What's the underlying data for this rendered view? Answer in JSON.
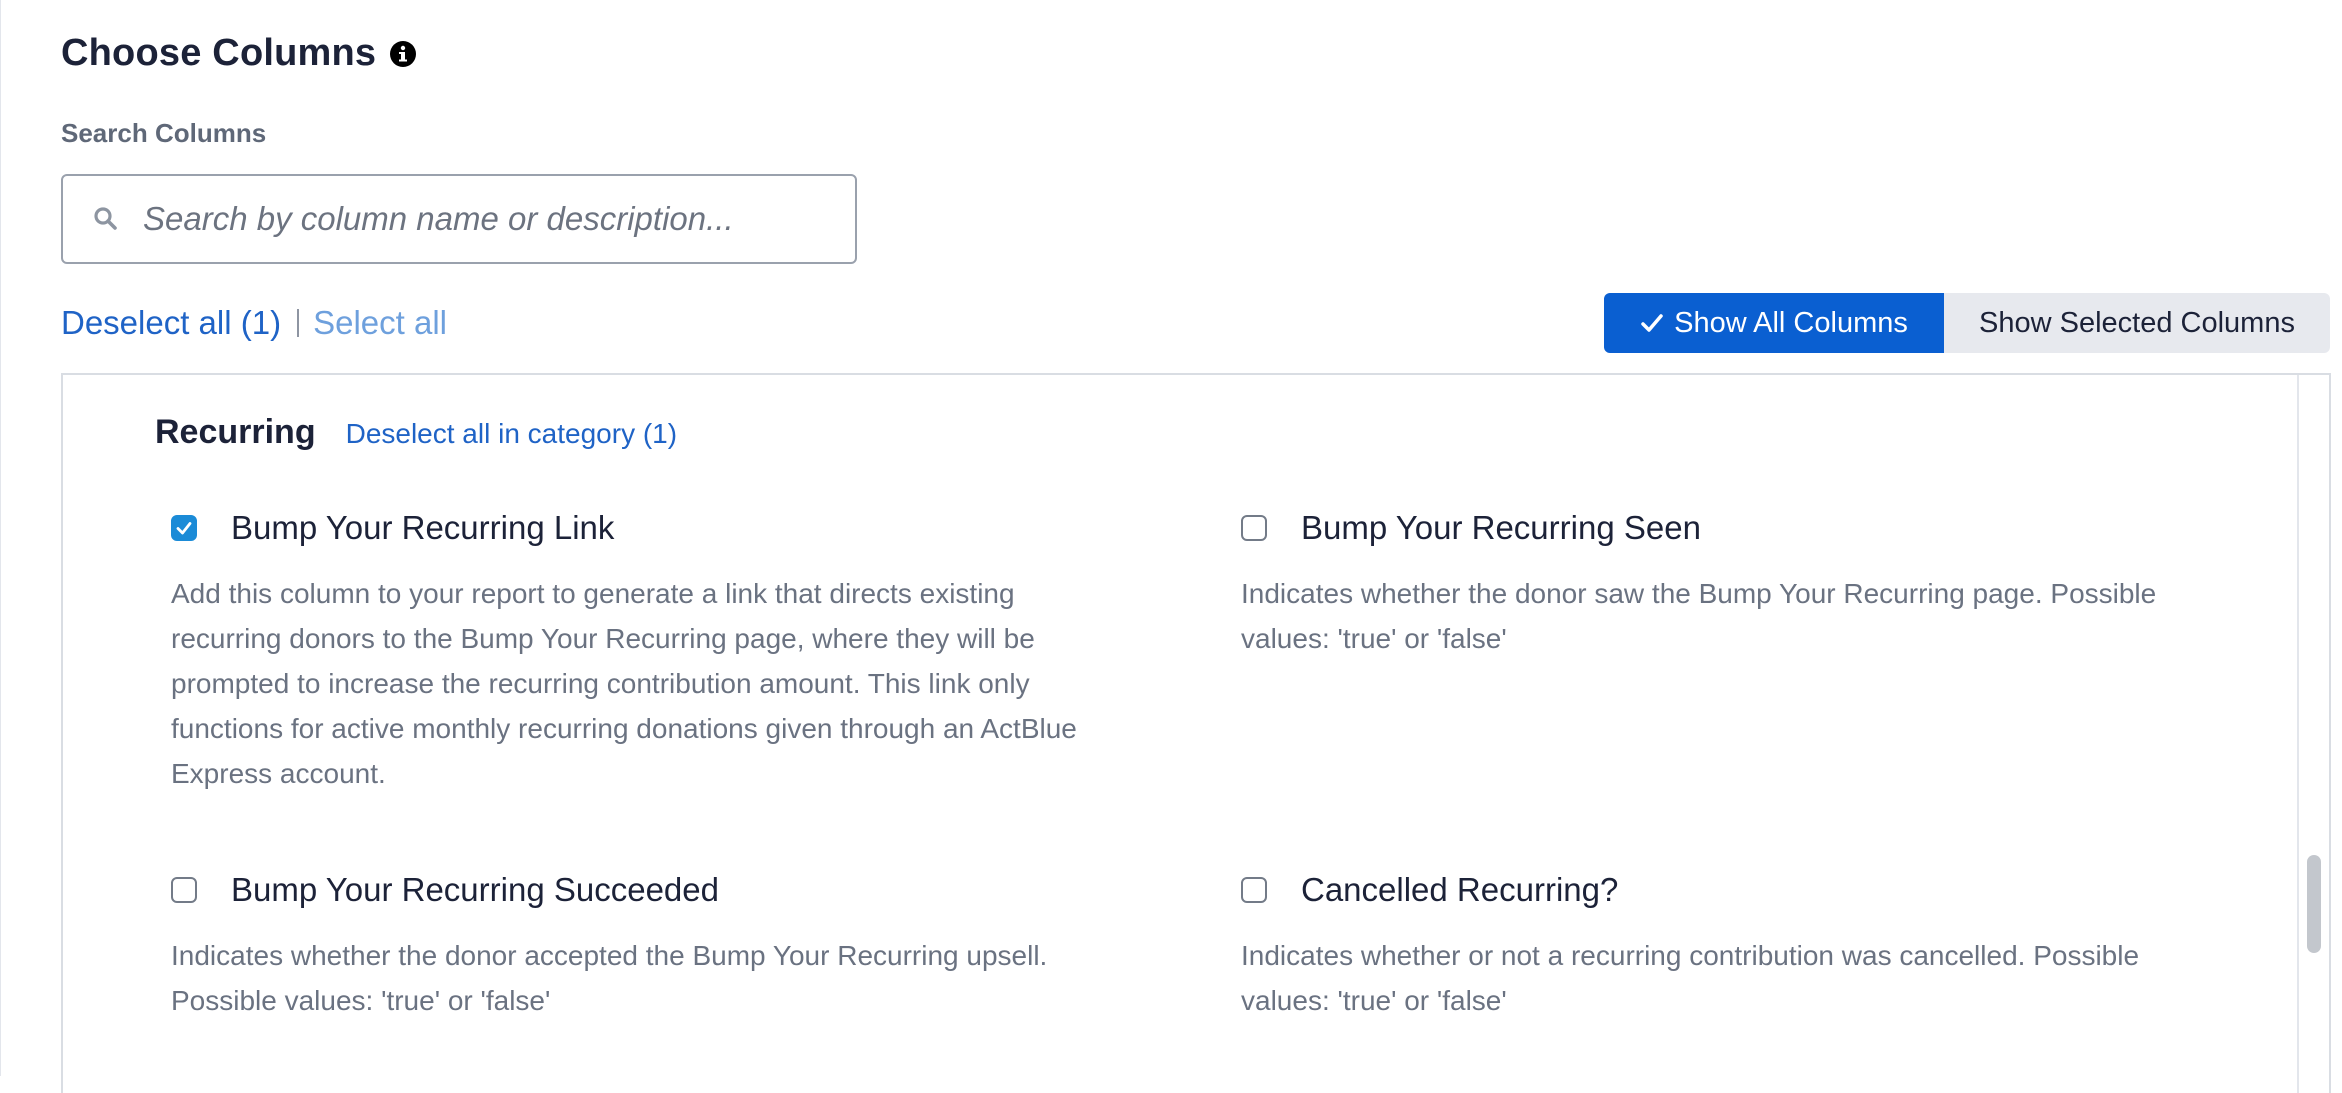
{
  "header": {
    "title": "Choose Columns",
    "info_icon": "info-circle-icon"
  },
  "search": {
    "label": "Search Columns",
    "placeholder": "Search by column name or description...",
    "value": "",
    "icon": "search-icon"
  },
  "selection": {
    "deselect_all": "Deselect all (1)",
    "select_all": "Select all"
  },
  "view_toggle": {
    "show_all": "Show All Columns",
    "show_selected": "Show Selected Columns",
    "active": "show_all"
  },
  "category": {
    "title": "Recurring",
    "deselect_label": "Deselect all in category (1)",
    "columns": [
      {
        "name": "Bump Your Recurring Link",
        "checked": true,
        "description": "Add this column to your report to generate a link that directs existing recurring donors to the Bump Your Recurring page, where they will be prompted to increase the recurring contribution amount. This link only functions for active monthly recurring donations given through an ActBlue Express account."
      },
      {
        "name": "Bump Your Recurring Seen",
        "checked": false,
        "description": "Indicates whether the donor saw the Bump Your Recurring page. Possible values: 'true' or 'false'"
      },
      {
        "name": "Bump Your Recurring Succeeded",
        "checked": false,
        "description": "Indicates whether the donor accepted the Bump Your Recurring upsell. Possible values: 'true' or 'false'"
      },
      {
        "name": "Cancelled Recurring?",
        "checked": false,
        "description": "Indicates whether or not a recurring contribution was cancelled. Possible values: 'true' or 'false'"
      }
    ]
  },
  "colors": {
    "primary": "#0a5fd1",
    "link": "#1f63c6",
    "checkbox_checked": "#1b8bd7",
    "text_muted": "#6a7281"
  }
}
